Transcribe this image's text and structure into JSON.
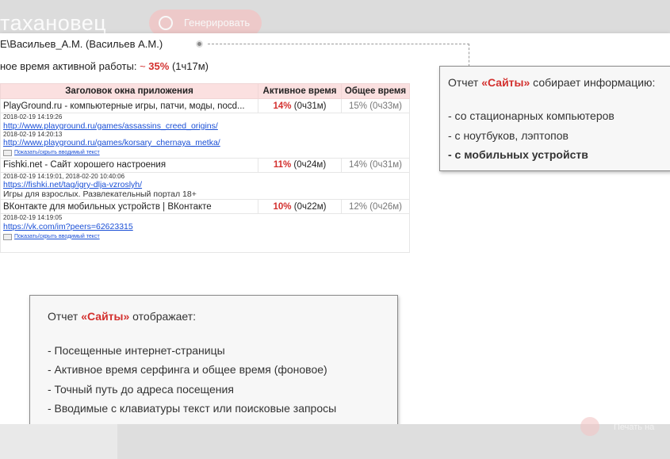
{
  "background": {
    "brand_text": "тахановец",
    "generate_button": "Генерировать",
    "faded_bottom": "Печать на"
  },
  "header": {
    "user_line": "E\\Васильев_А.М. (Васильев А.М.)",
    "active_label": "ное время активной работы:",
    "active_tilde": "~",
    "active_percent": "35%",
    "active_duration": "(1ч17м)"
  },
  "table": {
    "columns": [
      "Заголовок окна приложения",
      "Активное время",
      "Общее время"
    ],
    "rows": [
      {
        "title": "PlayGround.ru - компьютерные игры, патчи, моды, nocd...",
        "active_pct": "14%",
        "active_time": "(0ч31м)",
        "total": "15% (0ч33м)",
        "details": {
          "entries": [
            {
              "timestamp": "2018-02-19 14:19:26",
              "url": "http://www.playground.ru/games/assassins_creed_origins/"
            },
            {
              "timestamp": "2018-02-19 14:20:13",
              "url": "http://www.playground.ru/games/korsary_chernaya_metka/"
            }
          ],
          "toggle": "Показать/скрыть вводимый текст"
        }
      },
      {
        "title": "Fishki.net - Сайт хорошего настроения",
        "active_pct": "11%",
        "active_time": "(0ч24м)",
        "total": "14% (0ч31м)",
        "details": {
          "entries": [
            {
              "timestamp": "2018-02-19 14:19:01, 2018-02-20 10:40:06",
              "url": "https://fishki.net/tag/igry-dlja-vzroslyh/"
            }
          ],
          "typed_text": "Игры для взрослых. Развлекательный портал 18+"
        }
      },
      {
        "title": "ВКонтакте для мобильных устройств | ВКонтакте",
        "active_pct": "10%",
        "active_time": "(0ч22м)",
        "total": "12% (0ч26м)",
        "details": {
          "entries": [
            {
              "timestamp": "2018-02-19 14:19:05",
              "url": "https://vk.com/im?peers=62623315"
            }
          ],
          "toggle": "Показать/скрыть вводимый текст"
        }
      }
    ]
  },
  "callout1": {
    "intro_before": "Отчет ",
    "intro_highlight": "«Сайты»",
    "intro_after": " собирает информацию:",
    "items": [
      "- со стационарных компьютеров",
      "- с ноутбуков, лэптопов",
      "- с мобильных устройств"
    ]
  },
  "callout2": {
    "intro_before": "Отчет ",
    "intro_highlight": "«Сайты»",
    "intro_after": " отображает:",
    "items": [
      "- Посещенные интернет-страницы",
      "- Активное время серфинга и общее время (фоновое)",
      "- Точный путь до адреса посещения",
      "- Вводимые с клавиатуры текст или поисковые запросы"
    ]
  },
  "colors": {
    "accent": "#d3302e",
    "link": "#1a4fd6",
    "header_bg": "#fbe0e0"
  }
}
